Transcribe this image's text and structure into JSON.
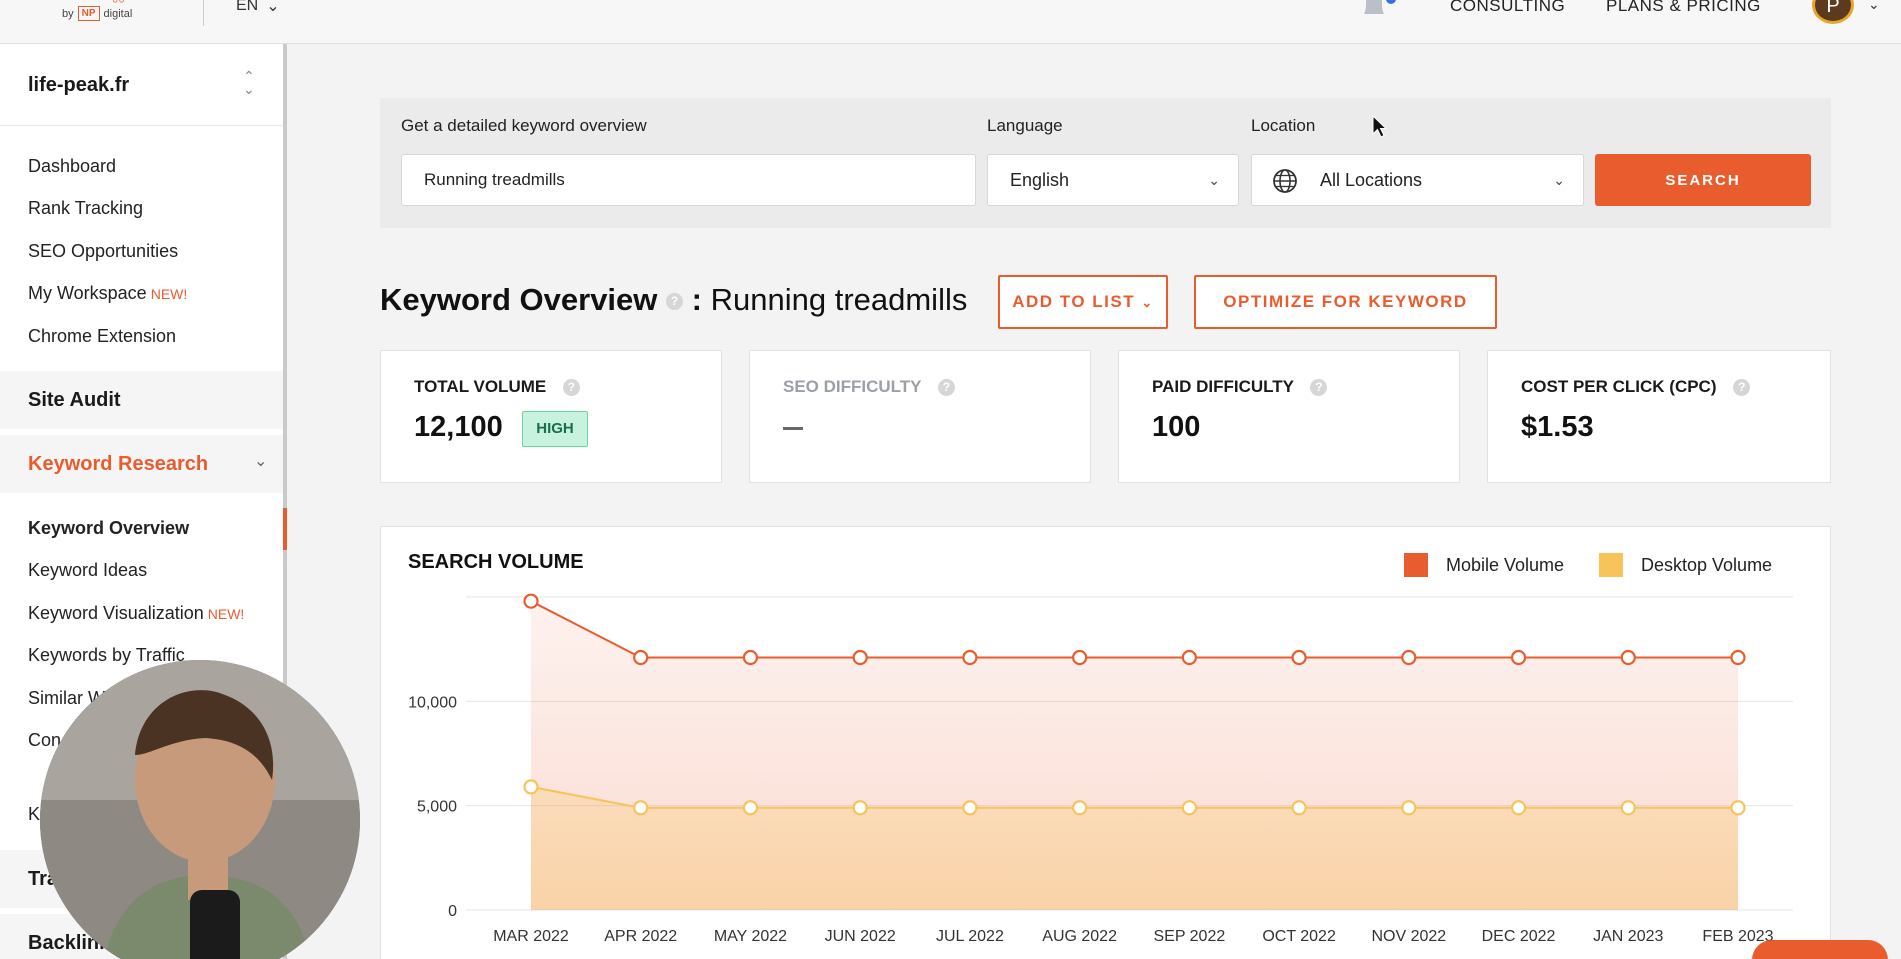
{
  "topbar": {
    "logo_by": "by",
    "logo_np": "NP",
    "logo_digital": "digital",
    "language": "EN",
    "consulting": "CONSULTING",
    "plans_pricing": "PLANS & PRICING",
    "avatar_initial": "P"
  },
  "sidebar": {
    "project": "life-peak.fr",
    "items": [
      {
        "label": "Dashboard"
      },
      {
        "label": "Rank Tracking"
      },
      {
        "label": "SEO Opportunities"
      },
      {
        "label": "My Workspace",
        "badge": "NEW!"
      },
      {
        "label": "Chrome Extension"
      }
    ],
    "site_audit": "Site Audit",
    "keyword_research": "Keyword Research",
    "kr_items": [
      {
        "label": "Keyword Overview"
      },
      {
        "label": "Keyword Ideas"
      },
      {
        "label": "Keyword Visualization",
        "badge": "NEW!"
      },
      {
        "label": "Keywords by Traffic"
      },
      {
        "label": "Similar W"
      },
      {
        "label": "Con"
      },
      {
        "label": "K"
      }
    ],
    "traffic_partial": "Tra",
    "backlinks_partial": "Backlink"
  },
  "search": {
    "keyword_label": "Get a detailed keyword overview",
    "keyword_value": "Running treadmills",
    "language_label": "Language",
    "language_value": "English",
    "location_label": "Location",
    "location_value": "All Locations",
    "button": "SEARCH"
  },
  "overview": {
    "title": "Keyword Overview",
    "help": "?",
    "separator": ":",
    "keyword": "Running treadmills",
    "add_to_list": "ADD TO LIST",
    "optimize": "OPTIMIZE FOR KEYWORD"
  },
  "metrics": {
    "total_volume_label": "TOTAL VOLUME",
    "total_volume_value": "12,100",
    "total_volume_badge": "HIGH",
    "seo_difficulty_label": "SEO DIFFICULTY",
    "paid_difficulty_label": "PAID DIFFICULTY",
    "paid_difficulty_value": "100",
    "cpc_label": "COST PER CLICK (CPC)",
    "cpc_value": "$1.53"
  },
  "colors": {
    "accent": "#e95c2e",
    "mobile": "#e95c2e",
    "desktop": "#f7c35a",
    "badge_bg": "#c7f2de"
  },
  "chart_data": {
    "type": "line",
    "title": "SEARCH VOLUME",
    "x": [
      "MAR 2022",
      "APR 2022",
      "MAY 2022",
      "JUN 2022",
      "JUL 2022",
      "AUG 2022",
      "SEP 2022",
      "OCT 2022",
      "NOV 2022",
      "DEC 2022",
      "JAN 2023",
      "FEB 2023"
    ],
    "series": [
      {
        "name": "Mobile Volume",
        "color": "#e95c2e",
        "values": [
          14800,
          12100,
          12100,
          12100,
          12100,
          12100,
          12100,
          12100,
          12100,
          12100,
          12100,
          12100
        ]
      },
      {
        "name": "Desktop Volume",
        "color": "#f7c35a",
        "values": [
          5900,
          4900,
          4900,
          4900,
          4900,
          4900,
          4900,
          4900,
          4900,
          4900,
          4900,
          4900
        ]
      }
    ],
    "y_ticks": [
      "0",
      "5,000",
      "10,000"
    ],
    "y_tick_values": [
      0,
      5000,
      10000
    ],
    "ylim": [
      0,
      15000
    ],
    "legend_position": "top-right",
    "grid": true
  }
}
